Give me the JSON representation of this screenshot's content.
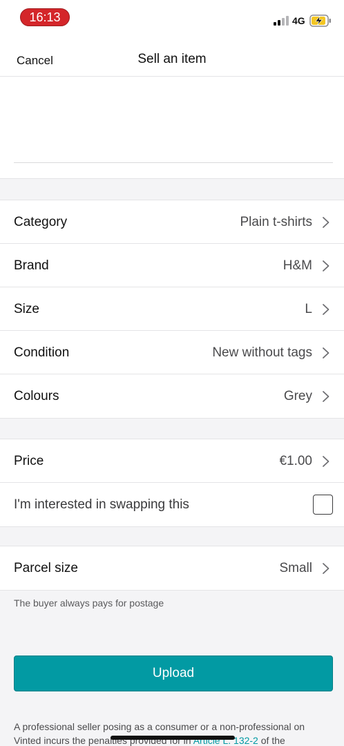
{
  "status_bar": {
    "time": "16:13",
    "network": "4G",
    "time_pill_color": "#d4262a",
    "battery_color": "#f3c623",
    "battery_icon": "charging-battery-icon",
    "signal_icon": "signal-bars-icon"
  },
  "nav": {
    "cancel_label": "Cancel",
    "title": "Sell an item"
  },
  "details": [
    {
      "label": "Category",
      "value": "Plain t-shirts"
    },
    {
      "label": "Brand",
      "value": "H&M"
    },
    {
      "label": "Size",
      "value": "L"
    },
    {
      "label": "Condition",
      "value": "New without tags"
    },
    {
      "label": "Colours",
      "value": "Grey"
    }
  ],
  "pricing": {
    "price_label": "Price",
    "price_value": "€1.00",
    "swap_label": "I'm interested in swapping this",
    "swap_checked": false
  },
  "shipping": {
    "parcel_label": "Parcel size",
    "parcel_value": "Small",
    "note": "The buyer always pays for postage"
  },
  "upload_label": "Upload",
  "legal": {
    "part1": "A professional seller posing as a consumer or a non-professional on Vinted incurs the penalties provided for in ",
    "link": "Article L. 132-2",
    "part2": " of the"
  },
  "colors": {
    "accent": "#029aa3",
    "background": "#f4f4f6"
  }
}
